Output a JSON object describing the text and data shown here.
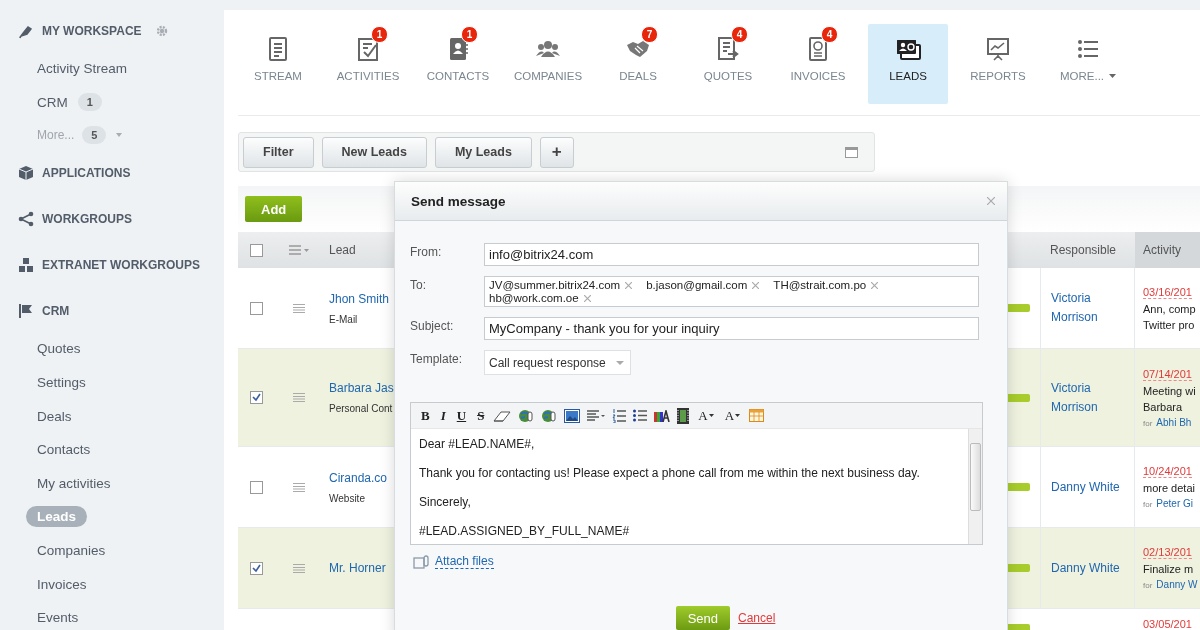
{
  "sidebar": {
    "sections": [
      {
        "label": "MY WORKSPACE",
        "settings": true,
        "items": [
          {
            "label": "Activity Stream",
            "selected": false
          },
          {
            "label": "CRM",
            "count": "1",
            "selected": false
          },
          {
            "label": "More...",
            "count": "5",
            "kind": "more",
            "selected": false
          }
        ]
      },
      {
        "label": "APPLICATIONS"
      },
      {
        "label": "WORKGROUPS"
      },
      {
        "label": "EXTRANET WORKGROUPS"
      },
      {
        "label": "CRM",
        "items": [
          {
            "label": "Quotes",
            "selected": false
          },
          {
            "label": "Settings",
            "selected": false
          },
          {
            "label": "Deals",
            "selected": false
          },
          {
            "label": "Contacts",
            "selected": false
          },
          {
            "label": "My activities",
            "selected": false
          },
          {
            "label": "Leads",
            "selected": true
          },
          {
            "label": "Companies",
            "selected": false
          },
          {
            "label": "Invoices",
            "selected": false
          },
          {
            "label": "Events",
            "selected": false
          }
        ]
      }
    ]
  },
  "tabs": [
    {
      "label": "STREAM",
      "selected": false
    },
    {
      "label": "ACTIVITIES",
      "badge": "1",
      "selected": false
    },
    {
      "label": "CONTACTS",
      "badge": "1",
      "selected": false
    },
    {
      "label": "COMPANIES",
      "selected": false
    },
    {
      "label": "DEALS",
      "badge": "7",
      "selected": false
    },
    {
      "label": "QUOTES",
      "badge": "4",
      "selected": false
    },
    {
      "label": "INVOICES",
      "badge": "4",
      "selected": false
    },
    {
      "label": "LEADS",
      "selected": true
    },
    {
      "label": "REPORTS",
      "selected": false
    },
    {
      "label": "MORE...",
      "kind": "menu",
      "selected": false
    }
  ],
  "filters": {
    "buttons": [
      "Filter",
      "New Leads",
      "My Leads",
      "+"
    ]
  },
  "toolbar": {
    "add_button": "Add"
  },
  "table": {
    "columns": [
      "Lead",
      "Responsible",
      "Activity"
    ],
    "header_checked": false,
    "rows": [
      {
        "checked": false,
        "lead": "Jhon Smith",
        "source": "E-Mail",
        "responsible": "Victoria Morrison",
        "activity": {
          "date": "03/16/201",
          "lines": [
            "Ann, comp",
            "Twitter pro"
          ]
        }
      },
      {
        "checked": true,
        "lead": "Barbara Jas",
        "source": "Personal Cont",
        "responsible": "Victoria Morrison",
        "activity": {
          "date": "07/14/201",
          "lines": [
            "Meeting wi",
            "Barbara"
          ],
          "for": "for",
          "for_name": "Abhi Bh"
        }
      },
      {
        "checked": false,
        "lead": "Ciranda.co",
        "source": "Website",
        "responsible": "Danny White",
        "activity": {
          "date": "10/24/201",
          "lines": [
            "more detai"
          ],
          "for": "for",
          "for_name": "Peter Gi"
        }
      },
      {
        "checked": true,
        "lead": "Mr. Horner",
        "responsible": "Danny White",
        "activity": {
          "date": "02/13/201",
          "lines": [
            "Finalize m"
          ],
          "for": "for",
          "for_name": "Danny W"
        }
      },
      {
        "activity": {
          "date": "03/05/201"
        }
      }
    ]
  },
  "dialog": {
    "title": "Send message",
    "from": {
      "label": "From:",
      "value": "info@bitrix24.com"
    },
    "to": {
      "label": "To:",
      "recipients": [
        "JV@summer.bitrix24.com",
        "b.jason@gmail.com",
        "TH@strait.com.po",
        "hb@work.com.oe"
      ]
    },
    "subject": {
      "label": "Subject:",
      "value": "MyCompany - thank you for your inquiry"
    },
    "template": {
      "label": "Template:",
      "value": "Call request response"
    },
    "editor": {
      "toolbar": [
        {
          "kind": "bold",
          "label": "B"
        },
        {
          "kind": "italic",
          "label": "I"
        },
        {
          "kind": "underline",
          "label": "U"
        },
        {
          "kind": "strike",
          "label": "S"
        },
        {
          "kind": "eraser"
        },
        {
          "kind": "link"
        },
        {
          "kind": "unlink"
        },
        {
          "kind": "image"
        },
        {
          "kind": "align"
        },
        {
          "kind": "ordered"
        },
        {
          "kind": "bullets"
        },
        {
          "kind": "color"
        },
        {
          "kind": "video"
        },
        {
          "kind": "font",
          "label": "A"
        },
        {
          "kind": "size",
          "label": "A"
        },
        {
          "kind": "table"
        }
      ],
      "lines": [
        "Dear #LEAD.NAME#,",
        "Thank you for contacting us!  Please expect a phone call from me within the next business day.",
        "Sincerely,",
        "#LEAD.ASSIGNED_BY_FULL_NAME#"
      ]
    },
    "attach": "Attach files",
    "send": "Send",
    "cancel": "Cancel"
  }
}
